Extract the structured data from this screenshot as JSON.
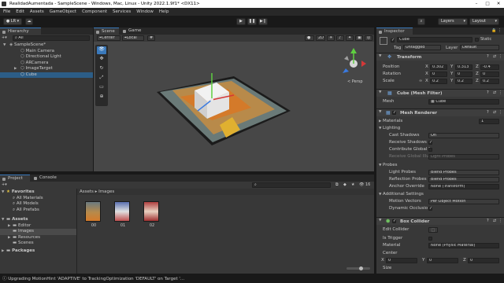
{
  "window": {
    "title": "RealidadAumentada - SampleScene - Windows, Mac, Linux - Unity 2022.1.9f1* <DX11>"
  },
  "menu": [
    "File",
    "Edit",
    "Assets",
    "GameObject",
    "Component",
    "Services",
    "Window",
    "Help"
  ],
  "toolbar": {
    "account": "LR",
    "layers": "Layers",
    "layout": "Layout"
  },
  "hierarchy": {
    "tab": "Hierarchy",
    "search_placeholder": "All",
    "scene": "SampleScene*",
    "items": [
      "Main Camera",
      "Directional Light",
      "ARCamera",
      "ImageTarget",
      "Cube"
    ]
  },
  "scene_view": {
    "tabs": [
      "Scene",
      "Game"
    ],
    "pivot": "Center",
    "space": "Local",
    "persp": "< Persp",
    "mode_2d": "2D"
  },
  "project": {
    "tabs": [
      "Project",
      "Console"
    ],
    "favorites_label": "Favorites",
    "favorites": [
      "All Materials",
      "All Models",
      "All Prefabs"
    ],
    "assets_label": "Assets",
    "asset_folders": [
      "Editor",
      "Images",
      "Resources",
      "Scenes"
    ],
    "packages_label": "Packages",
    "breadcrumb": [
      "Assets",
      "Images"
    ],
    "files": [
      "00",
      "01",
      "02"
    ],
    "file_count": "16"
  },
  "status": {
    "message": "Upgrading MotionHint 'ADAPTIVE' to TrackingOptimization 'DEFAULT' on Target '..."
  },
  "inspector": {
    "tab": "Inspector",
    "object_name": "Cube",
    "static_label": "Static",
    "tag_label": "Tag",
    "tag": "Untagged",
    "layer_label": "Layer",
    "layer": "Default",
    "transform": {
      "title": "Transform",
      "position_label": "Position",
      "rotation_label": "Rotation",
      "scale_label": "Scale",
      "position": [
        "0.302",
        "0.313",
        "-0.4"
      ],
      "rotation": [
        "0",
        "0",
        "0"
      ],
      "scale": [
        "0.2",
        "0.2",
        "0.2"
      ]
    },
    "mesh_filter": {
      "title": "Cube (Mesh Filter)",
      "mesh_label": "Mesh",
      "mesh": "Cube"
    },
    "mesh_renderer": {
      "title": "Mesh Renderer",
      "materials_label": "Materials",
      "materials_count": "1",
      "lighting_label": "Lighting",
      "cast_shadows_label": "Cast Shadows",
      "cast_shadows": "On",
      "receive_shadows_label": "Receive Shadows",
      "contribute_gi_label": "Contribute Global I",
      "receive_gi_label": "Receive Global Illu",
      "receive_gi": "Light Probes",
      "probes_label": "Probes",
      "light_probes_label": "Light Probes",
      "light_probes": "Blend Probes",
      "reflection_probes_label": "Reflection Probes",
      "reflection_probes": "Blend Probes",
      "anchor_override_label": "Anchor Override",
      "anchor_override": "None (Transform)",
      "additional_label": "Additional Settings",
      "motion_vectors_label": "Motion Vectors",
      "motion_vectors": "Per Object Motion",
      "dynamic_occlusion_label": "Dynamic Occlusio"
    },
    "box_collider": {
      "title": "Box Collider",
      "edit_collider_label": "Edit Collider",
      "is_trigger_label": "Is Trigger",
      "material_label": "Material",
      "material": "None (Physic Material)",
      "center_label": "Center",
      "center": [
        "0",
        "0",
        "0"
      ],
      "size_label": "Size"
    }
  },
  "colors": {
    "selection": "#2c5d87",
    "accent": "#3a79bb",
    "panel": "#383838",
    "header": "#282828"
  }
}
